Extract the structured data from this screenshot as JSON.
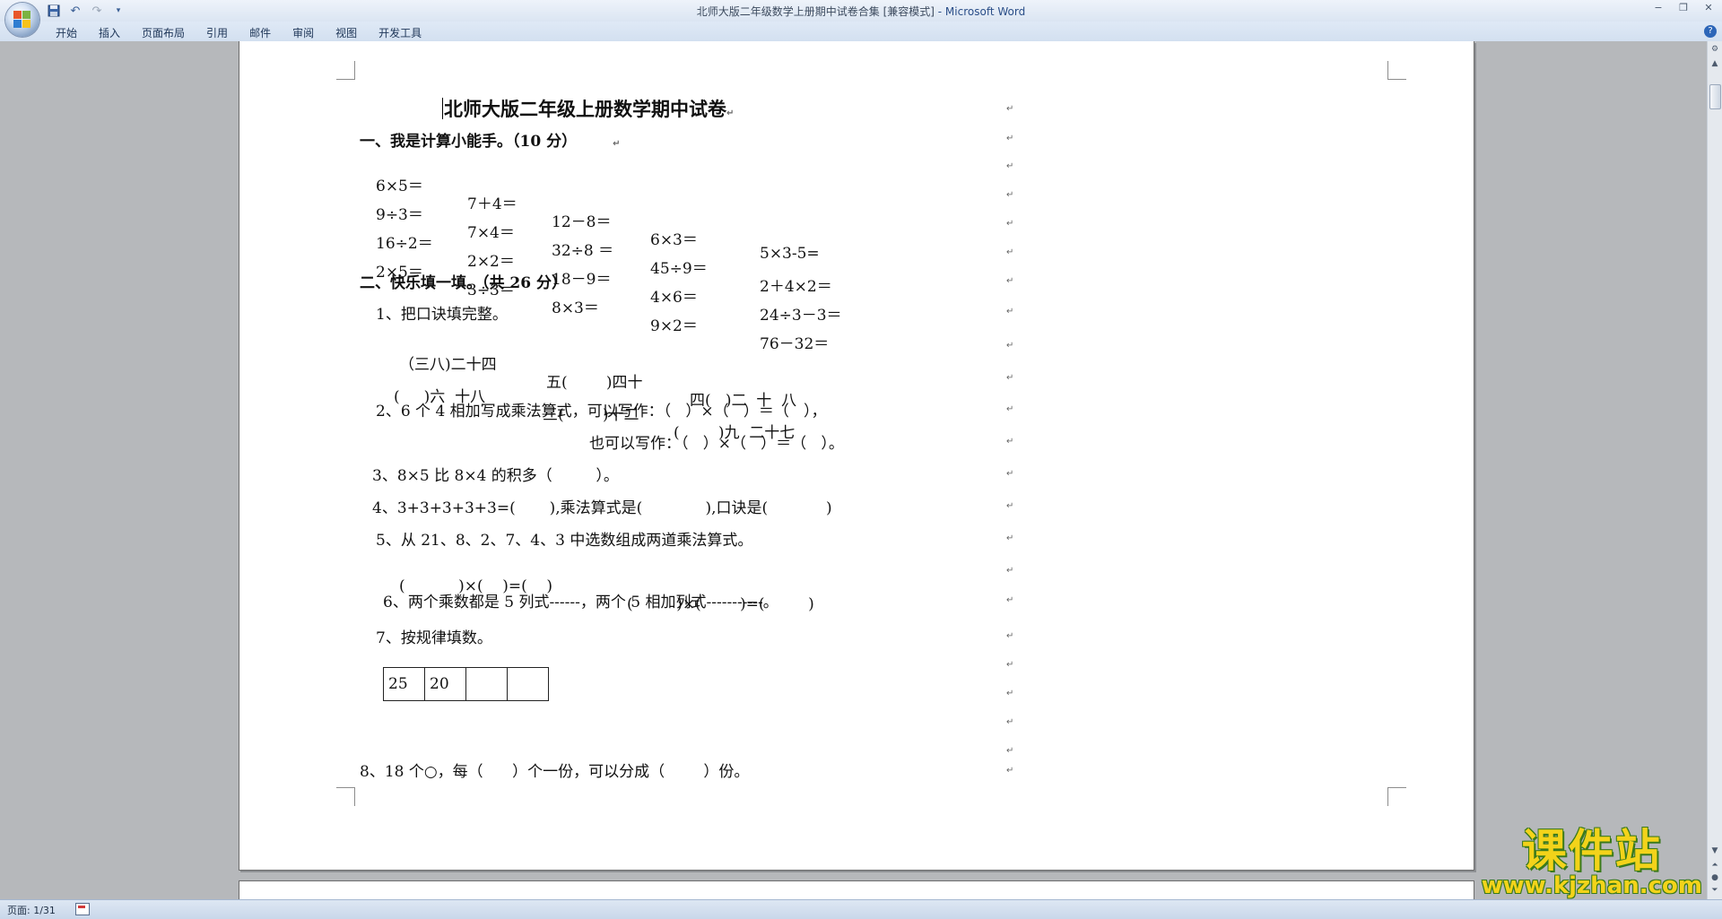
{
  "window": {
    "title": "北师大版二年级数学上册期中试卷合集 [兼容模式]",
    "app_name": " - Microsoft Word",
    "controls": [
      "−",
      "❐",
      "✕"
    ]
  },
  "qat": {
    "save_icon": "save-icon",
    "undo_icon": "undo-icon",
    "redo_icon": "redo-icon",
    "customize_icon": "dropdown-icon"
  },
  "ribbon": {
    "tabs": [
      "开始",
      "插入",
      "页面布局",
      "引用",
      "邮件",
      "审阅",
      "视图",
      "开发工具"
    ],
    "help": "?"
  },
  "document": {
    "title": "北师大版二年级上册数学期中试卷",
    "section1": {
      "heading": "一、我是计算小能手。（10 分）",
      "rows": [
        [
          "6×5＝",
          "7＋4＝",
          "12－8＝",
          "6×3＝",
          "5×3-5="
        ],
        [
          "9÷3＝",
          "7×4＝",
          "32÷8 ＝",
          "45÷9＝",
          "2＋4×2＝"
        ],
        [
          "16÷2＝",
          "2×2＝",
          "18－9＝",
          "4×6＝",
          "24÷3－3＝"
        ],
        [
          "2×5＝",
          "3÷3＝",
          "8×3＝",
          "9×2＝",
          "76－32＝"
        ]
      ]
    },
    "section2": {
      "heading": "二、快乐填一填。（共 26 分）",
      "q1": "1、把口诀填完整。",
      "q1_line1": [
        "（三八)二十四",
        "五(        )四十",
        "四(   )二  十  八"
      ],
      "q1_line2": [
        "(     )六  十八",
        "三(        )十二",
        "(        )九  二十七"
      ],
      "q2_a": "2、6 个 4 相加写成乘法算式，可以写作：（   ）×（   ）＝（   ），",
      "q2_b": "也可以写作：（   ）×（   ）＝（   ）。",
      "q3": "3、8×5 比 8×4 的积多（         ）。",
      "q4": "4、3+3+3+3+3=(       ),乘法算式是(             ),口诀是(            )",
      "q5": "5、从 21、8、2、7、4、3 中选数组成两道乘法算式。",
      "q5_line": [
        "(           )×(    )=(    )",
        "(         )×(        )=(         )"
      ],
      "q6": "6、两个乘数都是 5 列式------，两个 5 相加列式-----------。",
      "q7": "7、按规律填数。",
      "q7_cells": [
        "25",
        "20",
        "",
        ""
      ],
      "q8": "8、18 个○，每（      ）个一份，可以分成（        ）份。"
    },
    "para_mark": "↵"
  },
  "statusbar": {
    "page_info": "页面: 1/31"
  },
  "watermark": {
    "cn": "课件站",
    "url": "www.kjzhan.com"
  }
}
